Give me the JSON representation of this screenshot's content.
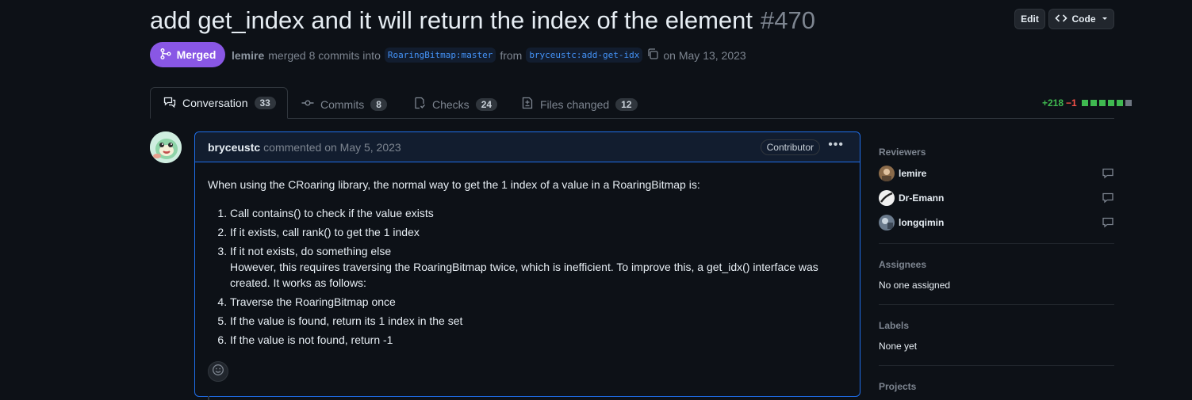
{
  "pr": {
    "title": "add get_index and it will return the index of the element",
    "number": "#470",
    "status": "Merged",
    "author": "lemire",
    "merged_text": "merged 8 commits into",
    "base_branch": "RoaringBitmap:master",
    "from_text": "from",
    "head_branch": "bryceustc:add-get-idx",
    "date_text": "on May 13, 2023"
  },
  "toolbar": {
    "edit_label": "Edit",
    "code_label": "Code"
  },
  "tabs": [
    {
      "label": "Conversation",
      "count": "33",
      "icon": "conversation-icon"
    },
    {
      "label": "Commits",
      "count": "8",
      "icon": "commit-icon"
    },
    {
      "label": "Checks",
      "count": "24",
      "icon": "checklist-icon"
    },
    {
      "label": "Files changed",
      "count": "12",
      "icon": "file-diff-icon"
    }
  ],
  "diffstat": {
    "additions": "+218",
    "deletions": "−1",
    "blocks": [
      "add",
      "add",
      "add",
      "add",
      "add",
      "neutral"
    ]
  },
  "comment": {
    "author": "bryceustc",
    "meta": "commented on May 5, 2023",
    "badge": "Contributor",
    "intro": "When using the CRoaring library, the normal way to get the 1 index of a value in a RoaringBitmap is:",
    "items": [
      "Call contains() to check if the value exists",
      "If it exists, call rank() to get the 1 index",
      "If it not exists, do something else",
      "Traverse the RoaringBitmap once",
      "If the value is found, return its 1 index in the set",
      "If the value is not found, return -1"
    ],
    "continuation": "However, this requires traversing the RoaringBitmap twice, which is inefficient. To improve this, a get_idx() interface was created. It works as follows:"
  },
  "sidebar": {
    "reviewers_label": "Reviewers",
    "reviewers": [
      "lemire",
      "Dr-Emann",
      "longqimin"
    ],
    "assignees_label": "Assignees",
    "assignees_value": "No one assigned",
    "labels_label": "Labels",
    "labels_value": "None yet",
    "projects_label": "Projects"
  },
  "colors": {
    "accent": "#8957e5",
    "link": "#4493f8",
    "add": "#3fb950",
    "del": "#f85149",
    "bg": "#0d1117"
  }
}
